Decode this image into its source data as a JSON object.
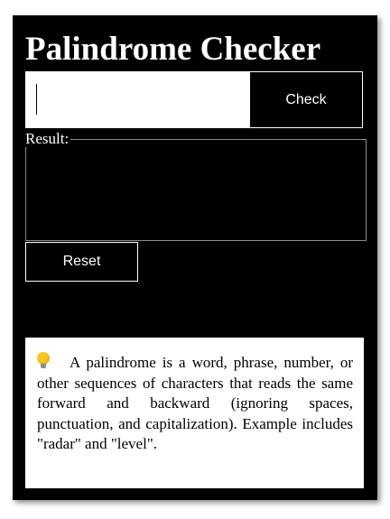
{
  "app": {
    "title": "Palindrome Checker"
  },
  "input": {
    "value": "",
    "placeholder": ""
  },
  "check_button": {
    "label": "Check"
  },
  "result": {
    "legend": "Result:",
    "output": ""
  },
  "reset_button": {
    "label": "Reset"
  },
  "info": {
    "icon": "lightbulb-icon",
    "text": "A palindrome is a word, phrase, number, or other sequences of characters that reads the same forward and backward (ignoring spaces, punctuation, and capitalization). Example includes \"radar\" and \"level\"."
  },
  "colors": {
    "background": "#000000",
    "accent": "#ffffff",
    "bulb": "#f7c51f"
  }
}
